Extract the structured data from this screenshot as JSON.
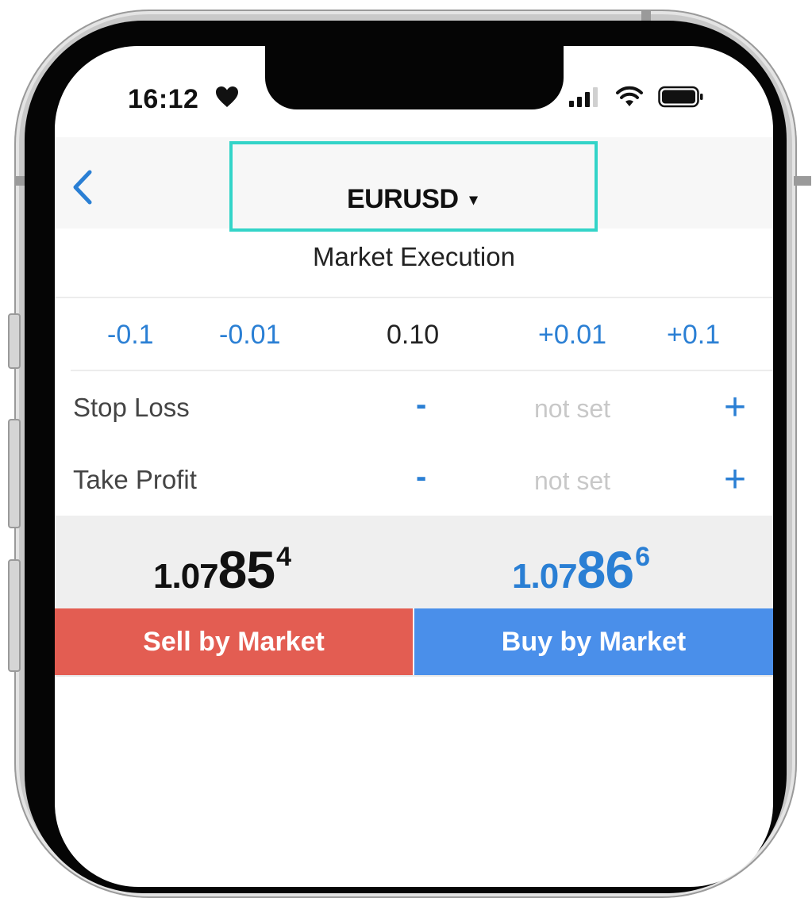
{
  "status_bar": {
    "time": "16:12"
  },
  "nav": {
    "symbol": "EURUSD",
    "caret": "▾"
  },
  "order": {
    "execution_mode": "Market Execution",
    "volume": {
      "dec_large": "-0.1",
      "dec_small": "-0.01",
      "value": "0.10",
      "inc_small": "+0.01",
      "inc_large": "+0.1"
    },
    "stop_loss": {
      "label": "Stop Loss",
      "minus": "-",
      "value": "not set",
      "plus": "+"
    },
    "take_profit": {
      "label": "Take Profit",
      "minus": "-",
      "value": "not set",
      "plus": "+"
    }
  },
  "quotes": {
    "bid": {
      "prefix": "1.07",
      "big": "85",
      "sup": "4"
    },
    "ask": {
      "prefix": "1.07",
      "big": "86",
      "sup": "6"
    }
  },
  "actions": {
    "sell_label": "Sell by Market",
    "buy_label": "Buy by Market"
  },
  "colors": {
    "accent_blue": "#2a7fd4",
    "sell_red": "#e35d52",
    "buy_blue": "#4a8fea",
    "highlight_teal": "#33d4c8"
  }
}
